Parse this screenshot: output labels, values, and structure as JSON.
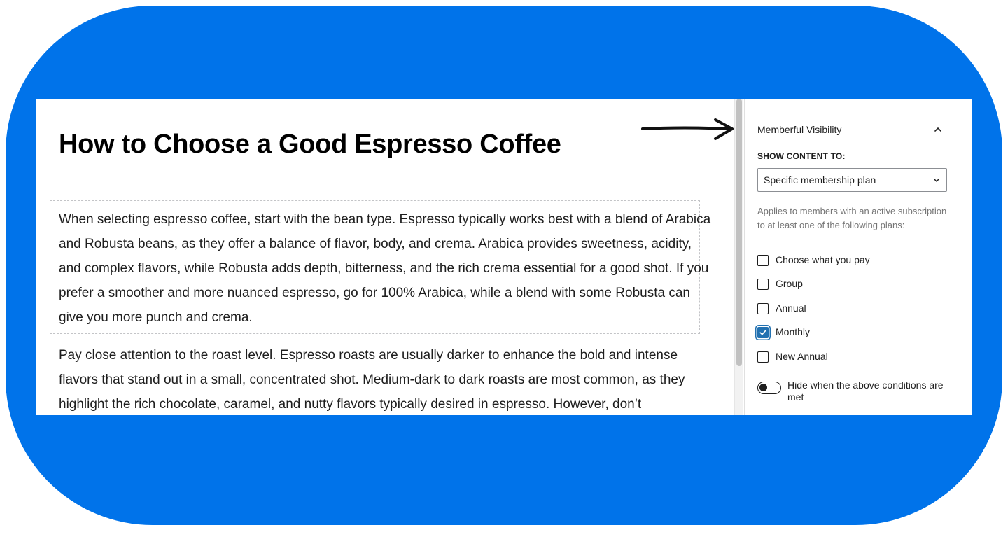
{
  "post": {
    "title": "How to Choose a Good Espresso Coffee",
    "paragraphs": [
      "When selecting espresso coffee, start with the bean type. Espresso typically works best with a blend of Arabica and Robusta beans, as they offer a balance of flavor, body, and crema. Arabica provides sweetness, acidity, and complex flavors, while Robusta adds depth, bitterness, and the rich crema essential for a good shot. If you prefer a smoother and more nuanced espresso, go for 100% Arabica, while a blend with some Robusta can give you more punch and crema.",
      "Pay close attention to the roast level. Espresso roasts are usually darker to enhance the bold and intense flavors that stand out in a small, concentrated shot. Medium-dark to dark roasts are most common, as they highlight the rich chocolate, caramel, and nutty flavors typically desired in espresso. However, don’t"
    ]
  },
  "sidebar": {
    "panel_title": "Memberful Visibility",
    "show_content_label": "SHOW CONTENT TO:",
    "select_value": "Specific membership plan",
    "help_text": "Applies to members with an active subscription to at least one of the following plans:",
    "plans": [
      {
        "label": "Choose what you pay",
        "checked": false
      },
      {
        "label": "Group",
        "checked": false
      },
      {
        "label": "Annual",
        "checked": false
      },
      {
        "label": "Monthly",
        "checked": true
      },
      {
        "label": "New Annual",
        "checked": false
      }
    ],
    "toggle_label": "Hide when the above conditions are met",
    "toggle_on": false
  },
  "colors": {
    "frame": "#0073ea",
    "accent": "#2271b1"
  },
  "icons": {
    "annotation": "arrow-right-icon",
    "collapse": "chevron-up-icon",
    "dropdown": "chevron-down-icon",
    "check": "checkmark-icon"
  }
}
